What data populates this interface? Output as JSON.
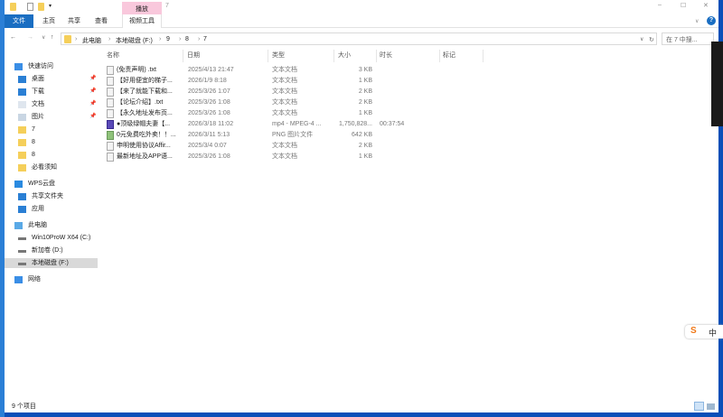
{
  "window": {
    "title": "7"
  },
  "ribbon": {
    "context_group": "播放",
    "context_tab": "视频工具",
    "tabs": [
      "文件",
      "主页",
      "共享",
      "查看"
    ]
  },
  "address": {
    "crumbs": [
      "此电脑",
      "本地磁盘 (F:)",
      "9",
      "8",
      "7"
    ],
    "search_placeholder": "在 7 中搜..."
  },
  "sidebar": {
    "items": [
      {
        "label": "快速访问",
        "icon": "star-icon",
        "pinned": false,
        "h": true
      },
      {
        "label": "桌面",
        "icon": "desktop-icon",
        "pinned": true
      },
      {
        "label": "下载",
        "icon": "download-icon",
        "pinned": true
      },
      {
        "label": "文档",
        "icon": "document-icon",
        "pinned": true
      },
      {
        "label": "图片",
        "icon": "pictures-icon",
        "pinned": true
      },
      {
        "label": "7",
        "icon": "folder-icon"
      },
      {
        "label": "8",
        "icon": "folder-icon"
      },
      {
        "label": "8",
        "icon": "folder-icon"
      },
      {
        "label": "必看须知",
        "icon": "folder-icon"
      },
      {
        "label": "WPS云盘",
        "icon": "cloud-icon",
        "h": true
      },
      {
        "label": "共享文件夹",
        "icon": "share-icon"
      },
      {
        "label": "应用",
        "icon": "apps-icon"
      },
      {
        "label": "此电脑",
        "icon": "computer-icon",
        "h": true
      },
      {
        "label": "Win10ProW X64 (C:)",
        "icon": "drive-icon"
      },
      {
        "label": "新加卷 (D:)",
        "icon": "drive-icon"
      },
      {
        "label": "本地磁盘 (F:)",
        "icon": "drive-icon",
        "selected": true
      },
      {
        "label": "网络",
        "icon": "network-icon",
        "h": true
      }
    ]
  },
  "columns": [
    "名称",
    "日期",
    "类型",
    "大小",
    "时长",
    "标记"
  ],
  "files": [
    {
      "name": "(免责声明) .txt",
      "date": "2025/4/13 21:47",
      "type": "文本文档",
      "size": "3 KB",
      "duration": ""
    },
    {
      "name": "【好用便宜的梯子...",
      "date": "2026/1/9 8:18",
      "type": "文本文档",
      "size": "1 KB",
      "duration": ""
    },
    {
      "name": "【来了就能下载和...",
      "date": "2025/3/26 1:07",
      "type": "文本文档",
      "size": "2 KB",
      "duration": ""
    },
    {
      "name": "【论坛介绍】.txt",
      "date": "2025/3/26 1:08",
      "type": "文本文档",
      "size": "2 KB",
      "duration": ""
    },
    {
      "name": "【永久地址发布页...",
      "date": "2025/3/26 1:08",
      "type": "文本文档",
      "size": "1 KB",
      "duration": ""
    },
    {
      "name": "●顶级绿帽夫妻【...",
      "date": "2026/3/18 11:02",
      "type": "mp4 - MPEG-4 ...",
      "size": "1,750,828...",
      "duration": "00:37:54",
      "kind": "video"
    },
    {
      "name": "0元免费吃外卖！！...",
      "date": "2026/3/11 5:13",
      "type": "PNG 图片文件",
      "size": "642 KB",
      "duration": "",
      "kind": "image"
    },
    {
      "name": "申明使用协议Affir...",
      "date": "2025/3/4 0:07",
      "type": "文本文档",
      "size": "2 KB",
      "duration": ""
    },
    {
      "name": "最新地址及APP语...",
      "date": "2025/3/26 1:08",
      "type": "文本文档",
      "size": "1 KB",
      "duration": ""
    }
  ],
  "status": {
    "count": "9 个项目"
  },
  "ime": {
    "label": "中"
  }
}
